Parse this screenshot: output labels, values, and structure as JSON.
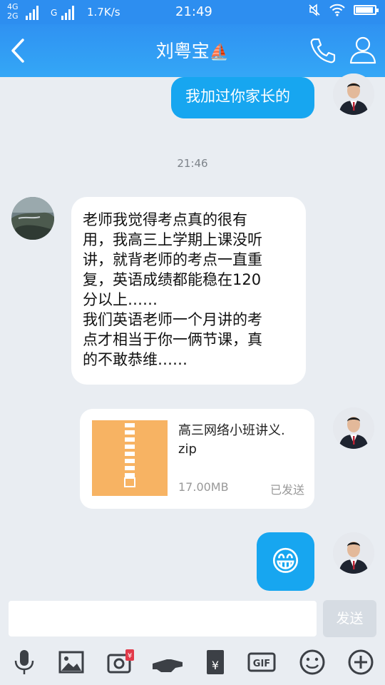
{
  "status_bar": {
    "net_top": "4G",
    "net_bottom": "2G",
    "net_third": "G",
    "speed": "1.7K/s",
    "time": "21:49"
  },
  "header": {
    "title": "刘粤宝",
    "title_emoji": "⛵"
  },
  "messages": {
    "out_1": "我加过你家长的",
    "timestamp": "21:46",
    "in_1_lines": [
      "老师我觉得考点真的很有",
      "用，我高三上学期上课没听",
      "讲，就背老师的考点一直重",
      "复，英语成绩都能稳在120",
      "分以上……",
      "我们英语老师一个月讲的考",
      "点才相当于你一俩节课，真",
      "的不敢恭维……"
    ],
    "file": {
      "name_line1": "高三网络小班讲义.",
      "name_line2": "zip",
      "size": "17.00MB",
      "status": "已发送"
    },
    "out_emoji": "😁"
  },
  "composer": {
    "placeholder": "",
    "send_label": "发送"
  },
  "toolbar": {
    "gif_label": "GIF",
    "redpacket_label": "¥"
  },
  "colors": {
    "accent": "#2d8ef0",
    "bubble_out": "#17a6f0",
    "chat_bg": "#e9edf2"
  }
}
